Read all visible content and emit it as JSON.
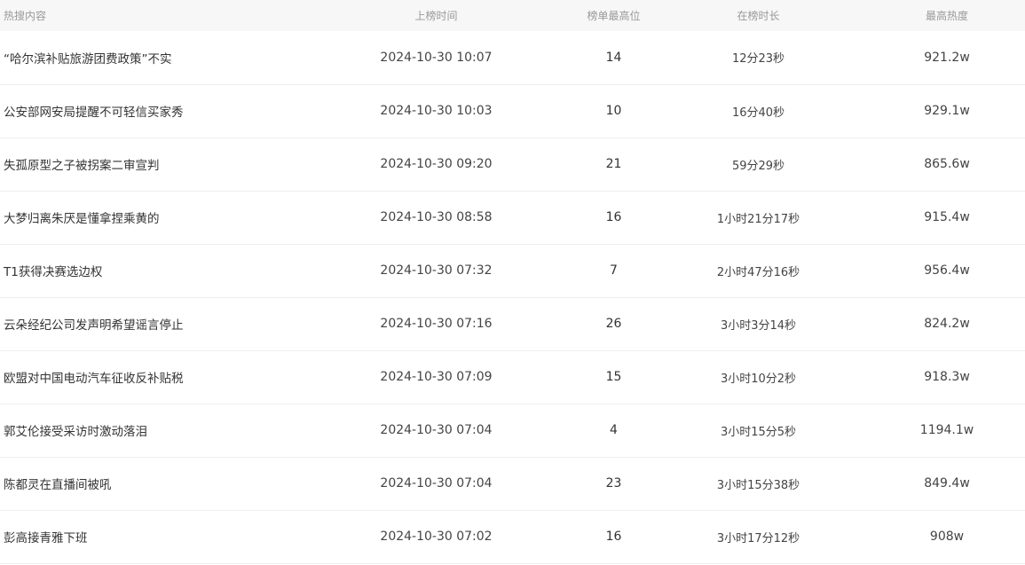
{
  "table": {
    "headers": {
      "title": "热搜内容",
      "time": "上榜时间",
      "rank": "榜单最高位",
      "duration": "在榜时长",
      "heat": "最高热度"
    },
    "rows": [
      {
        "title": "“哈尔滨补贴旅游团费政策”不实",
        "time": "2024-10-30 10:07",
        "rank": "14",
        "duration": "12分23秒",
        "heat": "921.2w"
      },
      {
        "title": "公安部网安局提醒不可轻信买家秀",
        "time": "2024-10-30 10:03",
        "rank": "10",
        "duration": "16分40秒",
        "heat": "929.1w"
      },
      {
        "title": "失孤原型之子被拐案二审宣判",
        "time": "2024-10-30 09:20",
        "rank": "21",
        "duration": "59分29秒",
        "heat": "865.6w"
      },
      {
        "title": "大梦归离朱厌是懂拿捏乘黄的",
        "time": "2024-10-30 08:58",
        "rank": "16",
        "duration": "1小时21分17秒",
        "heat": "915.4w"
      },
      {
        "title": "T1获得决赛选边权",
        "time": "2024-10-30 07:32",
        "rank": "7",
        "duration": "2小时47分16秒",
        "heat": "956.4w"
      },
      {
        "title": "云朵经纪公司发声明希望谣言停止",
        "time": "2024-10-30 07:16",
        "rank": "26",
        "duration": "3小时3分14秒",
        "heat": "824.2w"
      },
      {
        "title": "欧盟对中国电动汽车征收反补贴税",
        "time": "2024-10-30 07:09",
        "rank": "15",
        "duration": "3小时10分2秒",
        "heat": "918.3w"
      },
      {
        "title": "郭艾伦接受采访时激动落泪",
        "time": "2024-10-30 07:04",
        "rank": "4",
        "duration": "3小时15分5秒",
        "heat": "1194.1w"
      },
      {
        "title": "陈都灵在直播间被吼",
        "time": "2024-10-30 07:04",
        "rank": "23",
        "duration": "3小时15分38秒",
        "heat": "849.4w"
      },
      {
        "title": "彭高接青雅下班",
        "time": "2024-10-30 07:02",
        "rank": "16",
        "duration": "3小时17分12秒",
        "heat": "908w"
      }
    ]
  }
}
